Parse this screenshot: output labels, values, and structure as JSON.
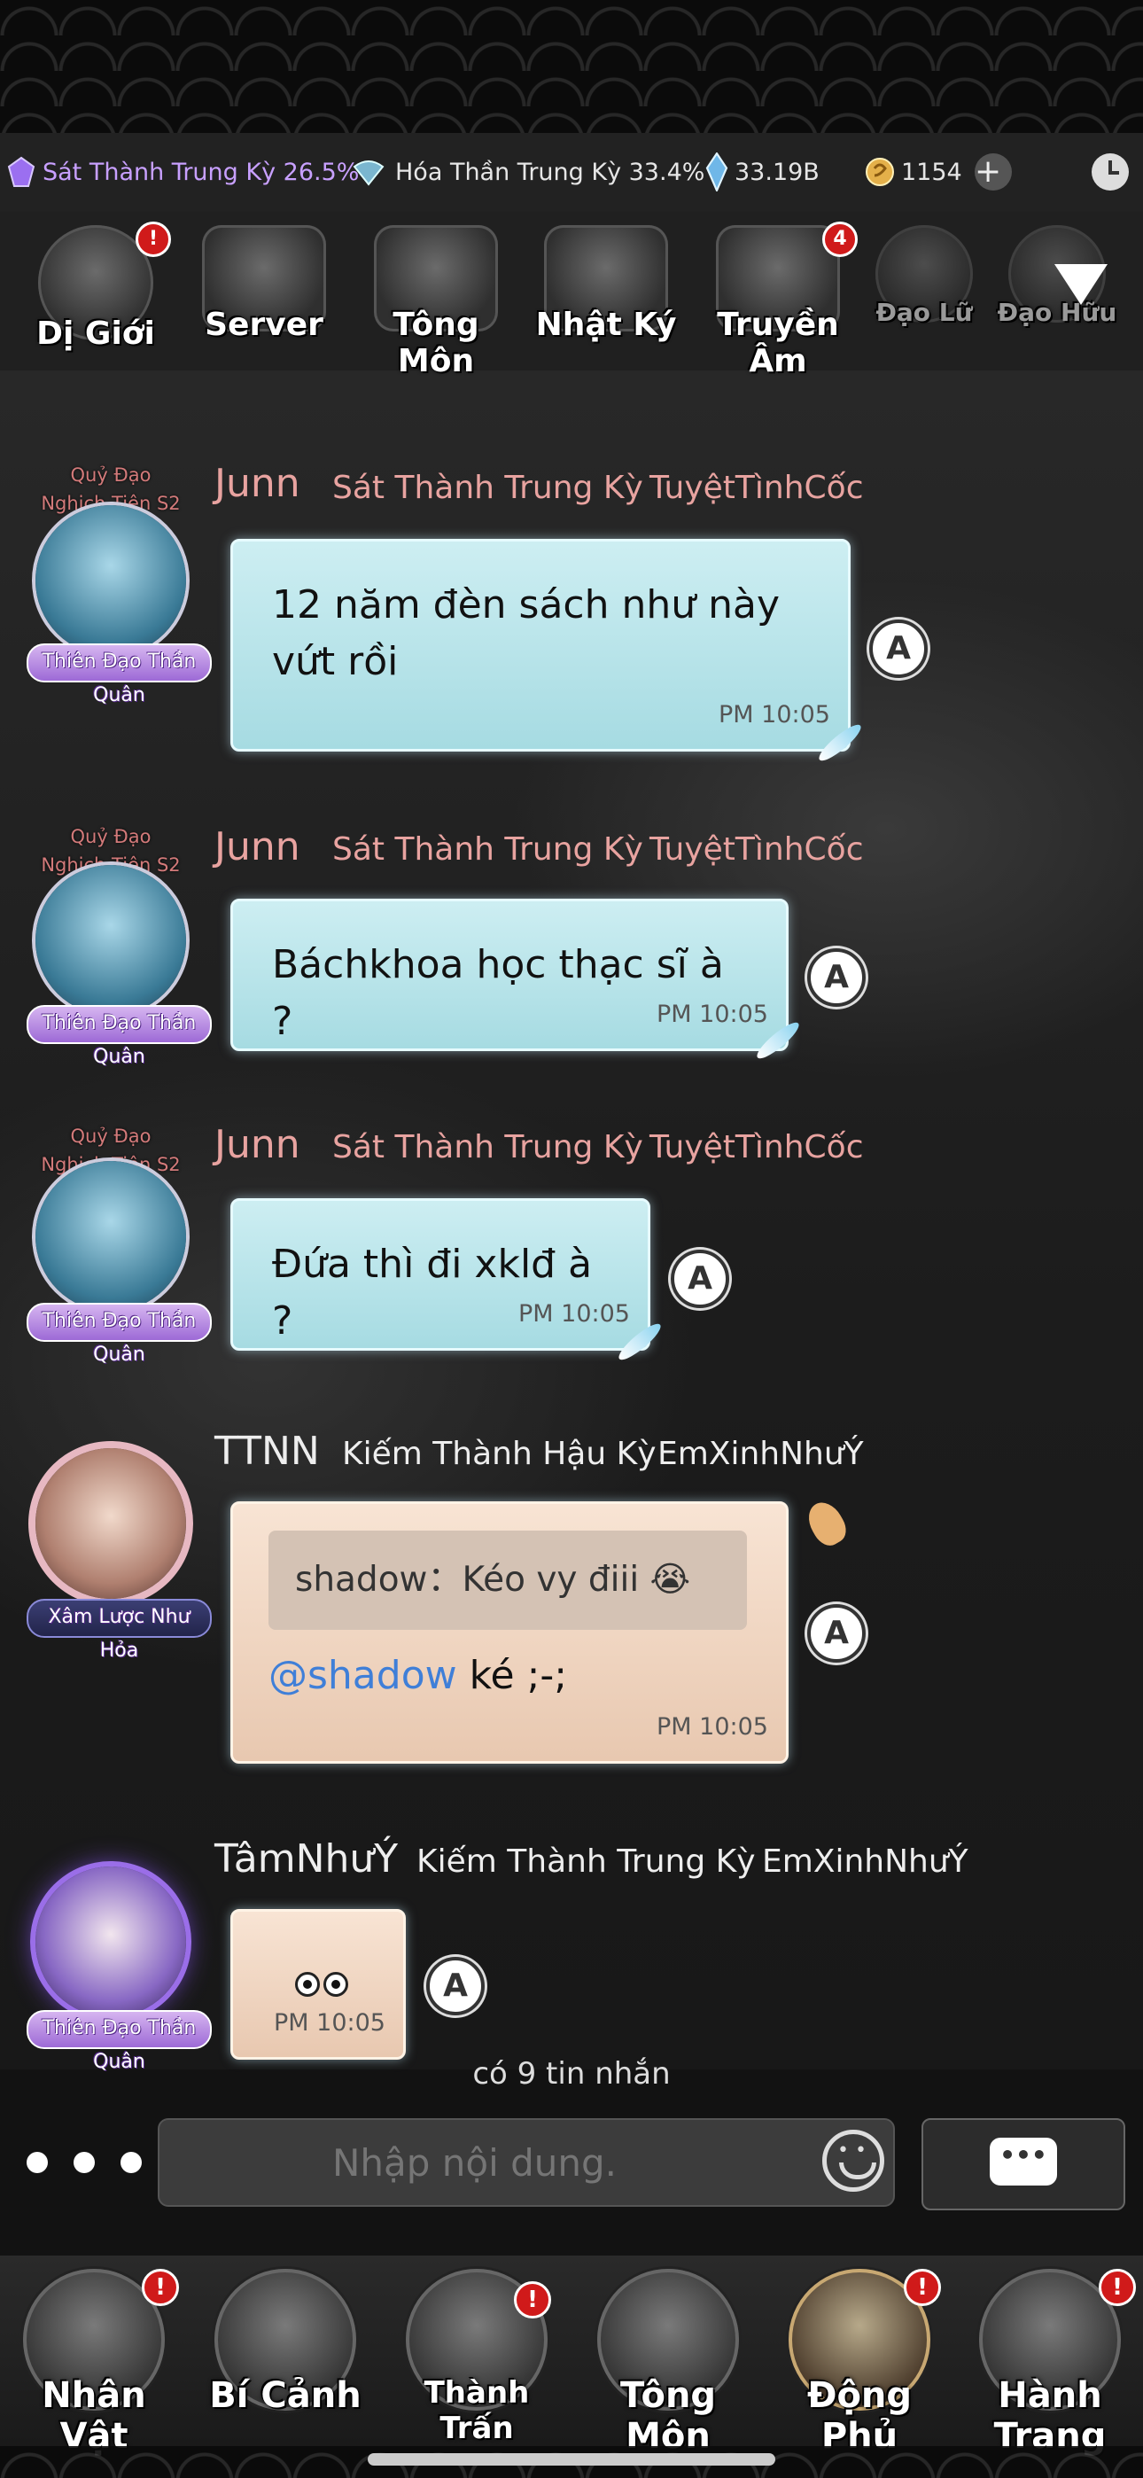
{
  "status": {
    "realm1": "Sát Thành Trung Kỳ 26.5%",
    "realm2": "Hóa Thần Trung Kỳ 33.4%",
    "crystal": "33.19B",
    "coins": "1154",
    "plus": "+"
  },
  "topnav": {
    "items": [
      {
        "label": "Dị Giới",
        "badge": "!"
      },
      {
        "label": "Server",
        "badge": ""
      },
      {
        "label": "Tông Môn",
        "badge": ""
      },
      {
        "label": "Nhật Ký",
        "badge": ""
      },
      {
        "label": "Truyền Âm",
        "badge": "4"
      },
      {
        "label": "Đạo Lữ",
        "badge": ""
      },
      {
        "label": "Đạo Hữu",
        "badge": ""
      }
    ]
  },
  "messages": [
    {
      "avatar_title": "Quỷ Đạo Nghịch Tiên S2",
      "badge": "Thiên Đạo Thần Quân",
      "username": "Junn",
      "realm": "Sát Thành Trung Kỳ",
      "guild": "TuyệtTìnhCốc",
      "line1": "12 năm đèn sách như này",
      "line2": "vứt rồi",
      "time": "PM 10:05"
    },
    {
      "avatar_title": "Quỷ Đạo Nghịch Tiên S2",
      "badge": "Thiên Đạo Thần Quân",
      "username": "Junn",
      "realm": "Sát Thành Trung Kỳ",
      "guild": "TuyệtTìnhCốc",
      "line1": "Báchkhoa học thạc sĩ à ?",
      "time": "PM 10:05"
    },
    {
      "avatar_title": "Quỷ Đạo Nghịch Tiên S2",
      "badge": "Thiên Đạo Thần Quân",
      "username": "Junn",
      "realm": "Sát Thành Trung Kỳ",
      "guild": "TuyệtTìnhCốc",
      "line1": "Đứa thì đi xklđ à ?",
      "time": "PM 10:05"
    },
    {
      "badge": "Xâm Lược Như Hỏa",
      "username": "TTNN",
      "realm": "Kiếm Thành Hậu Kỳ",
      "guild": "EmXinhNhưÝ",
      "quote": "shadow：Kéo vy điii 😭",
      "mention": "@shadow",
      "text": " ké ;-;",
      "time": "PM 10:05"
    },
    {
      "badge": "Thiên Đạo Thần Quân",
      "username": "TâmNhưÝ",
      "realm": "Kiếm Thành Trung Kỳ",
      "guild": "EmXinhNhưÝ",
      "time": "PM 10:05"
    }
  ],
  "reply_icon": "A",
  "chat": {
    "count": "có 9 tin nhắn",
    "placeholder": "Nhập nội dung.",
    "send_icon": "•••"
  },
  "bottomnav": {
    "items": [
      {
        "label": "Nhân Vật",
        "badge": "!"
      },
      {
        "label": "Bí Cảnh",
        "badge": ""
      },
      {
        "label": "Thành Trấn",
        "badge": "!"
      },
      {
        "label": "Tông Môn",
        "badge": ""
      },
      {
        "label": "Động Phủ",
        "badge": "!"
      },
      {
        "label": "Hành Trang",
        "badge": "!"
      }
    ]
  }
}
